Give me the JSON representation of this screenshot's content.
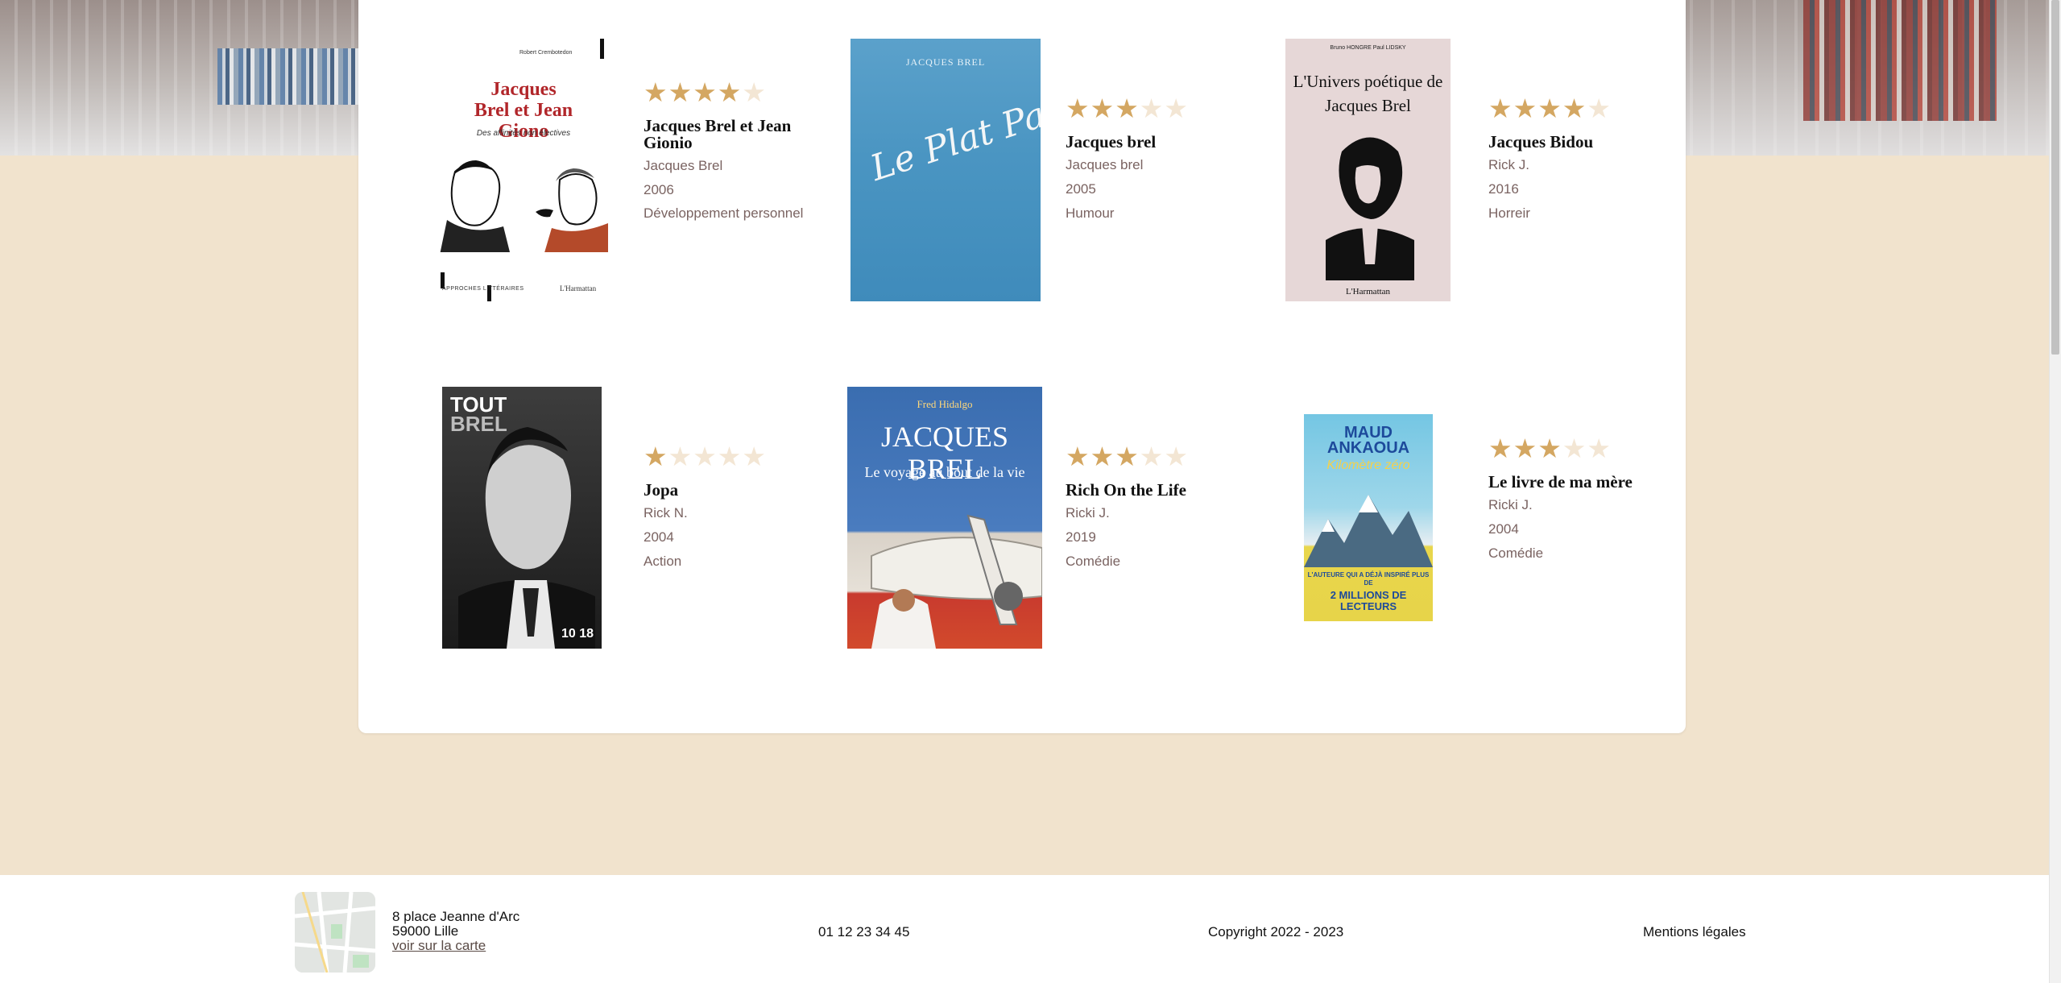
{
  "books": [
    {
      "rating": 4,
      "title": "Jacques Brel et Jean Gionio",
      "author": "Jacques Brel",
      "year": "2006",
      "genre": "Développement personnel",
      "cover": {
        "author": "Robert Crembotedon",
        "title": "Jacques Brel et Jean Giono",
        "subtitle": "Des affinités non électives",
        "series": "APPROCHES LITTÉRAIRES",
        "publisher": "L'Harmattan"
      }
    },
    {
      "rating": 3,
      "title": "Jacques brel",
      "author": "Jacques brel",
      "year": "2005",
      "genre": "Humour",
      "cover": {
        "author": "JACQUES BREL",
        "title": "Le Plat Pays"
      }
    },
    {
      "rating": 4,
      "title": "Jacques Bidou",
      "author": "Rick J.",
      "year": "2016",
      "genre": "Horreir",
      "cover": {
        "author": "Bruno HONGRE   Paul LIDSKY",
        "title": "L'Univers poétique de Jacques Brel",
        "publisher": "L'Harmattan"
      }
    },
    {
      "rating": 1,
      "title": "Jopa",
      "author": "Rick N.",
      "year": "2004",
      "genre": "Action",
      "cover": {
        "title_a": "TOUT",
        "title_b": "BREL",
        "publisher": "10 18"
      }
    },
    {
      "rating": 3,
      "title": "Rich On the Life",
      "author": "Ricki J.",
      "year": "2019",
      "genre": "Comédie",
      "cover": {
        "author": "Fred Hidalgo",
        "title": "JACQUES BREL",
        "subtitle": "Le voyage au bout de la vie"
      }
    },
    {
      "rating": 3,
      "title": "Le livre de ma mère",
      "author": "Ricki J.",
      "year": "2004",
      "genre": "Comédie",
      "cover": {
        "author": "MAUD ANKAOUA",
        "subtitle": "Kilomètre zéro",
        "blurb": "L'AUTEURE QUI A DÉJÀ INSPIRÉ PLUS DE",
        "claim": "2 MILLIONS DE LECTEURS"
      }
    }
  ],
  "footer": {
    "address_line1": "8 place Jeanne d'Arc",
    "address_line2": "59000 Lille",
    "map_link": "voir sur la carte",
    "phone": "01 12 23 34 45",
    "copyright": "Copyright 2022 - 2023",
    "legal": "Mentions légales"
  },
  "colors": {
    "star_on": "#d4a762",
    "star_off": "#f3e6d4",
    "page_bg": "#f1e3cd",
    "meta_text": "#7a6361"
  }
}
